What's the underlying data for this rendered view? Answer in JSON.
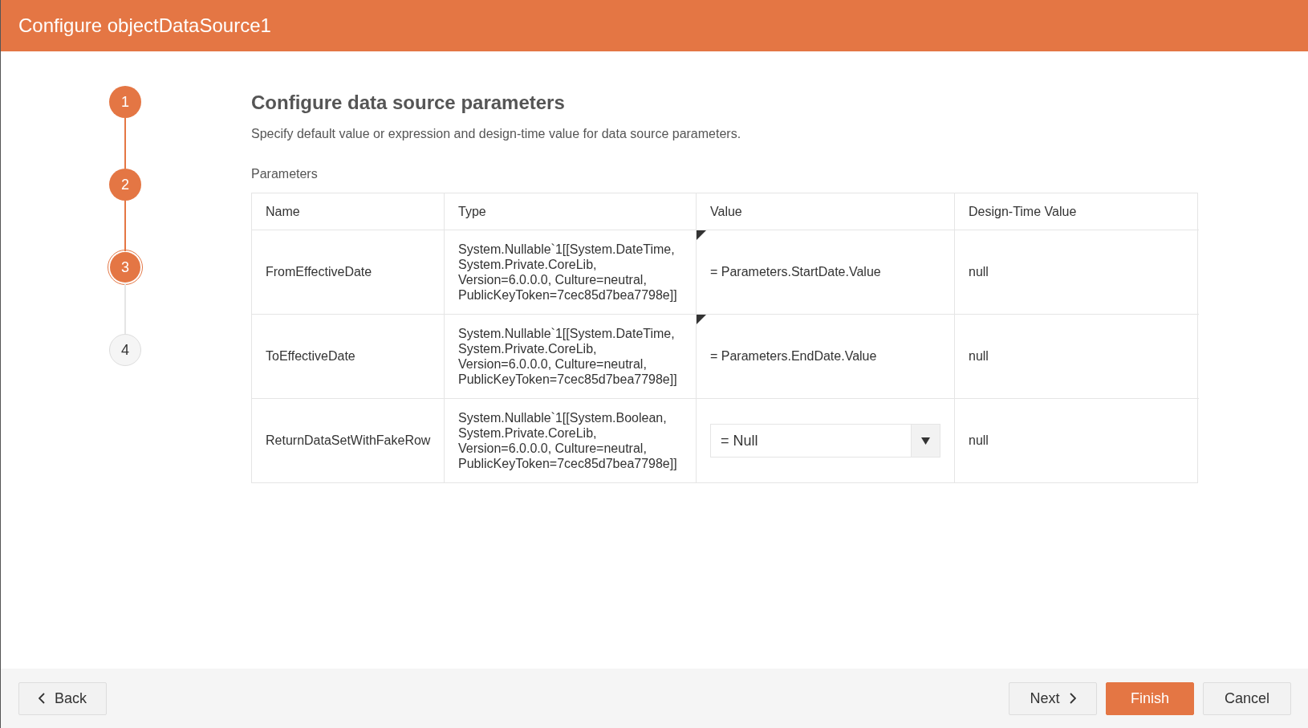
{
  "window": {
    "title": "Configure objectDataSource1"
  },
  "steps": [
    {
      "label": "1",
      "completed": true,
      "selected": false
    },
    {
      "label": "2",
      "completed": true,
      "selected": false
    },
    {
      "label": "3",
      "completed": false,
      "selected": true
    },
    {
      "label": "4",
      "completed": false,
      "selected": false
    }
  ],
  "heading": "Configure data source parameters",
  "description": "Specify default value or expression and design-time value for data source parameters.",
  "section_label": "Parameters",
  "table": {
    "columns": [
      "Name",
      "Type",
      "Value",
      "Design-Time Value"
    ],
    "rows": [
      {
        "name": "FromEffectiveDate",
        "type": "System.Nullable`1[[System.DateTime, System.Private.CoreLib, Version=6.0.0.0, Culture=neutral, PublicKeyToken=7cec85d7bea7798e]]",
        "value": {
          "kind": "expression",
          "text": "= Parameters.StartDate.Value"
        },
        "design_time_value": "null"
      },
      {
        "name": "ToEffectiveDate",
        "type": "System.Nullable`1[[System.DateTime, System.Private.CoreLib, Version=6.0.0.0, Culture=neutral, PublicKeyToken=7cec85d7bea7798e]]",
        "value": {
          "kind": "expression",
          "text": "= Parameters.EndDate.Value"
        },
        "design_time_value": "null"
      },
      {
        "name": "ReturnDataSetWithFakeRow",
        "type": "System.Nullable`1[[System.Boolean, System.Private.CoreLib, Version=6.0.0.0, Culture=neutral, PublicKeyToken=7cec85d7bea7798e]]",
        "value": {
          "kind": "dropdown",
          "text": "= Null"
        },
        "design_time_value": "null"
      }
    ]
  },
  "footer": {
    "back": "Back",
    "next": "Next",
    "finish": "Finish",
    "cancel": "Cancel"
  }
}
